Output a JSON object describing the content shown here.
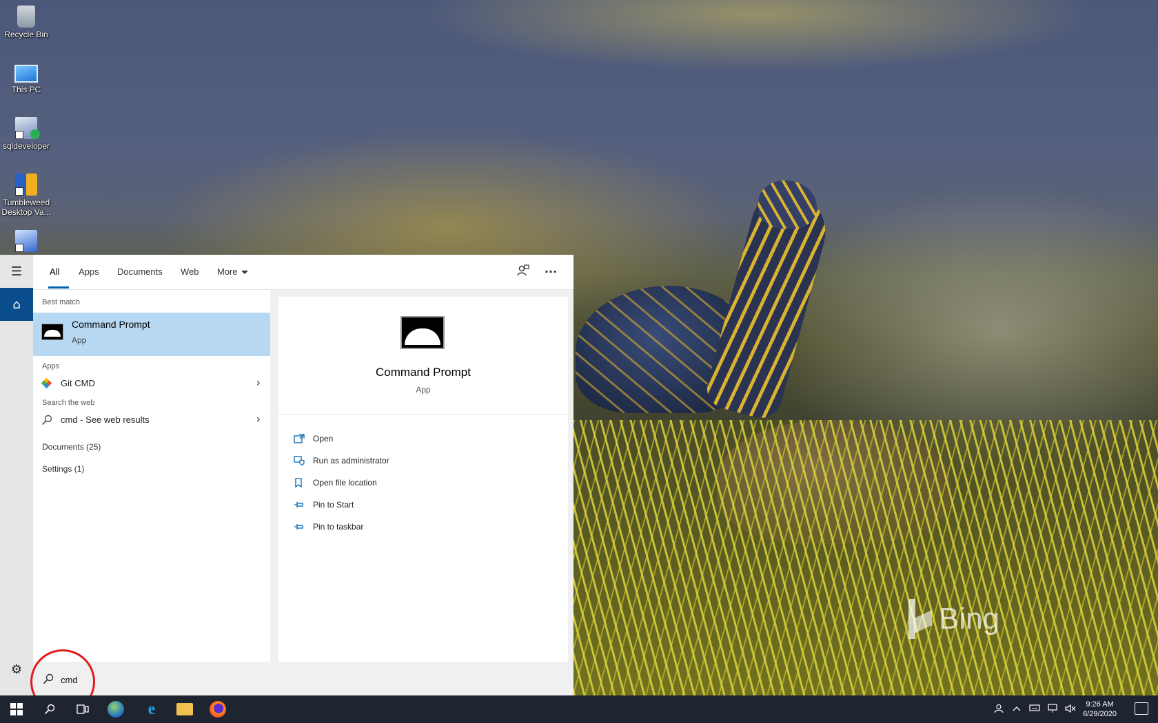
{
  "desktop": {
    "icons": [
      {
        "label": "Recycle Bin",
        "icon": "recycle-bin-icon"
      },
      {
        "label": "This PC",
        "icon": "computer-icon"
      },
      {
        "label": "sqldeveloper",
        "icon": "sqldeveloper-icon"
      },
      {
        "label": "Tumbleweed Desktop Va...",
        "icon": "tumbleweed-icon"
      },
      {
        "label": "",
        "icon": "remote-desktop-icon"
      }
    ],
    "bing_text": "Bing"
  },
  "start_rail": {
    "menu_icon": "☰",
    "home_icon": "⌂",
    "settings_icon": "⚙"
  },
  "search_panel": {
    "tabs": [
      {
        "label": "All",
        "active": true
      },
      {
        "label": "Apps"
      },
      {
        "label": "Documents"
      },
      {
        "label": "Web"
      },
      {
        "label": "More"
      }
    ],
    "feedback_icon": "feedback-icon",
    "options_label": "···",
    "best_match_header": "Best match",
    "best_match": {
      "title": "Command Prompt",
      "subtitle": "App"
    },
    "apps_header": "Apps",
    "apps": [
      {
        "label": "Git CMD"
      }
    ],
    "web_header": "Search the web",
    "web": [
      {
        "label": "cmd - See web results"
      }
    ],
    "documents_label": "Documents (25)",
    "settings_label": "Settings (1)",
    "detail": {
      "title": "Command Prompt",
      "subtitle": "App",
      "actions": [
        {
          "label": "Open",
          "icon": "open-icon"
        },
        {
          "label": "Run as administrator",
          "icon": "shield-icon"
        },
        {
          "label": "Open file location",
          "icon": "file-location-icon"
        },
        {
          "label": "Pin to Start",
          "icon": "pin-icon"
        },
        {
          "label": "Pin to taskbar",
          "icon": "pin-icon"
        }
      ]
    },
    "search_value": "cmd"
  },
  "taskbar": {
    "clock_time": "9:26 AM",
    "clock_date": "6/29/2020"
  },
  "annotation_color": "#e21b1b"
}
